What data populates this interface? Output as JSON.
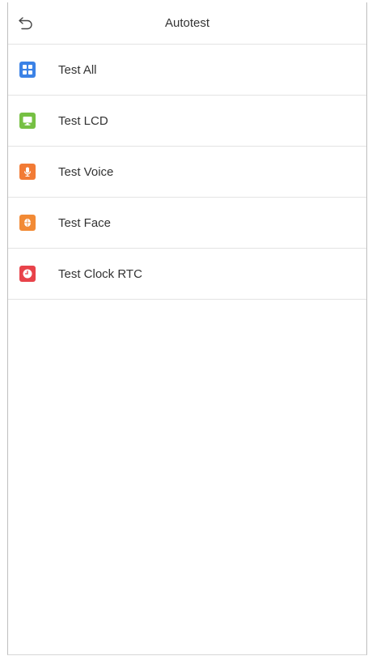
{
  "header": {
    "title": "Autotest",
    "back_icon": "back-arrow-icon"
  },
  "items": [
    {
      "label": "Test All",
      "icon": "grid-icon",
      "color": "#3b82e6"
    },
    {
      "label": "Test LCD",
      "icon": "monitor-icon",
      "color": "#76c043"
    },
    {
      "label": "Test Voice",
      "icon": "microphone-icon",
      "color": "#f27b35"
    },
    {
      "label": "Test Face",
      "icon": "face-icon",
      "color": "#f28a35"
    },
    {
      "label": "Test Clock RTC",
      "icon": "clock-icon",
      "color": "#e8434a"
    }
  ]
}
